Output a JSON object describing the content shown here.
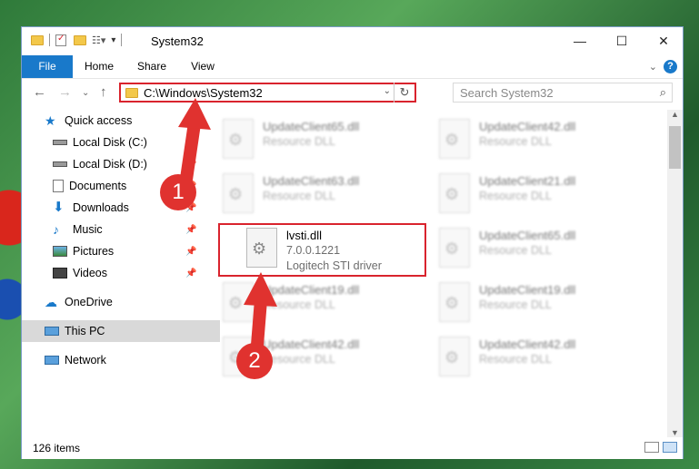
{
  "window": {
    "title": "System32"
  },
  "ribbon": {
    "tabs": [
      "File",
      "Home",
      "Share",
      "View"
    ]
  },
  "address_bar": {
    "path": "C:\\Windows\\System32"
  },
  "search": {
    "placeholder": "Search System32"
  },
  "nav": {
    "items": [
      {
        "label": "Quick access",
        "icon": "star-icon",
        "pinned": false
      },
      {
        "label": "Local Disk (C:)",
        "icon": "drive-icon",
        "pinned": true
      },
      {
        "label": "Local Disk (D:)",
        "icon": "drive-icon",
        "pinned": true
      },
      {
        "label": "Documents",
        "icon": "documents-icon",
        "pinned": true
      },
      {
        "label": "Downloads",
        "icon": "download-icon",
        "pinned": true
      },
      {
        "label": "Music",
        "icon": "music-icon",
        "pinned": true
      },
      {
        "label": "Pictures",
        "icon": "pictures-icon",
        "pinned": true
      },
      {
        "label": "Videos",
        "icon": "videos-icon",
        "pinned": true
      },
      {
        "label": "OneDrive",
        "icon": "cloud-icon",
        "pinned": false
      },
      {
        "label": "This PC",
        "icon": "computer-icon",
        "pinned": false,
        "selected": true
      },
      {
        "label": "Network",
        "icon": "network-icon",
        "pinned": false
      }
    ]
  },
  "files": [
    {
      "name": "UpdateClient65.dll",
      "desc": "Resource DLL"
    },
    {
      "name": "UpdateClient42.dll",
      "desc": "Resource DLL"
    },
    {
      "name": "UpdateClient63.dll",
      "desc": "Resource DLL"
    },
    {
      "name": "UpdateClient21.dll",
      "desc": "Resource DLL"
    },
    {
      "name": "lvsti.dll",
      "version": "7.0.0.1221",
      "desc": "Logitech STI driver"
    },
    {
      "name": "UpdateClient65.dll",
      "desc": "Resource DLL"
    },
    {
      "name": "UpdateClient19.dll",
      "desc": "Resource DLL"
    },
    {
      "name": "UpdateClient19.dll",
      "desc": "Resource DLL"
    },
    {
      "name": "UpdateClient42.dll",
      "desc": "Resource DLL"
    },
    {
      "name": "UpdateClient42.dll",
      "desc": "Resource DLL"
    }
  ],
  "status": {
    "item_count": "126 items"
  },
  "annotations": {
    "step1": "1",
    "step2": "2"
  },
  "colors": {
    "highlight_red": "#d9232d",
    "file_tab_blue": "#1979ca"
  }
}
